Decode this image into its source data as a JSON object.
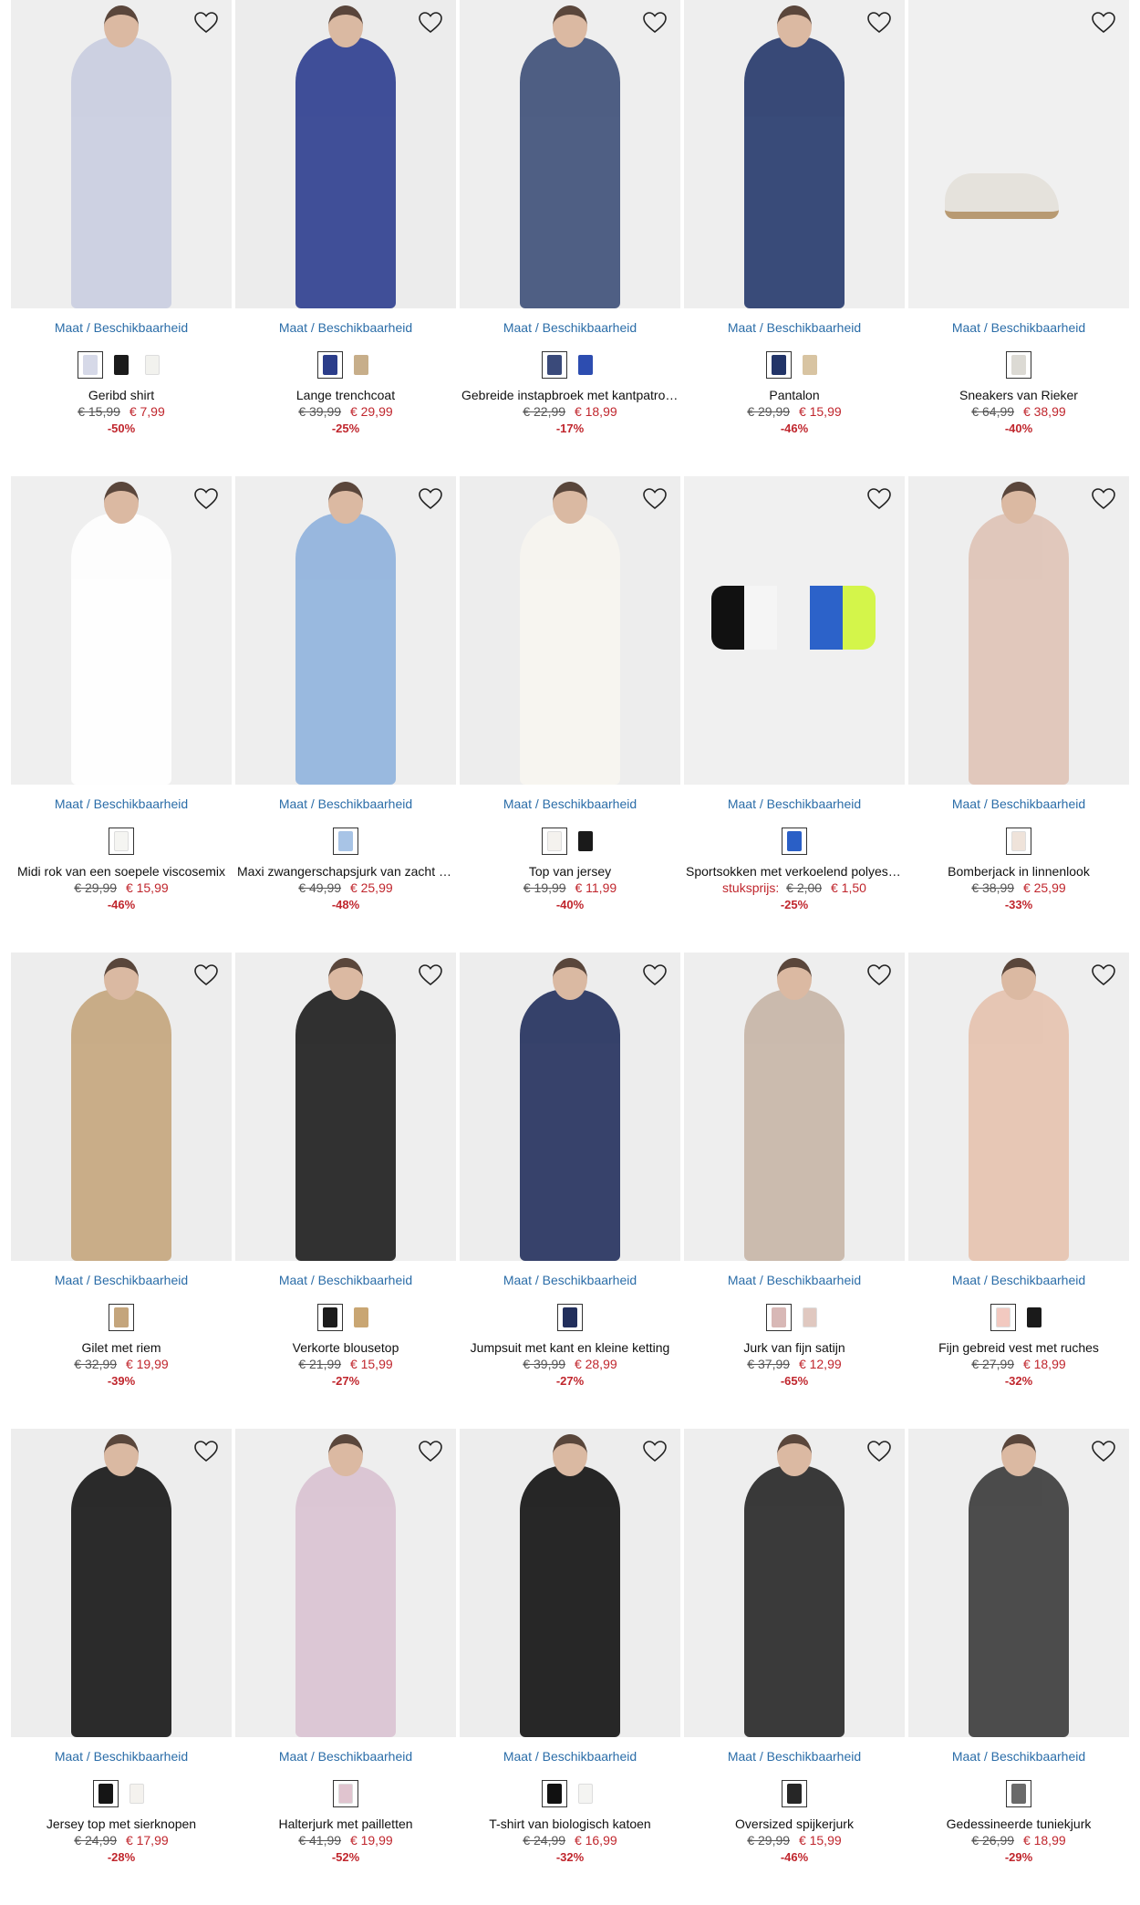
{
  "accent_color": "#2b6da8",
  "sale_color": "#c0262d",
  "size_link_prefix": "Maat",
  "size_link_sep": " / ",
  "size_link_suffix": "Beschikbaarheid",
  "products": [
    {
      "name": "Geribd shirt",
      "old": "€ 15,99",
      "new": "€ 7,99",
      "discount": "-50%",
      "label": "",
      "bg": "#eeeeee",
      "fig": "#c9cde0",
      "swatches": [
        "#d6d9e8",
        "#1b1b1b",
        "#f2f2ee"
      ]
    },
    {
      "name": "Lange trenchcoat",
      "old": "€ 39,99",
      "new": "€ 29,99",
      "discount": "-25%",
      "label": "",
      "bg": "#ececec",
      "fig": "#2d3e8f",
      "swatches": [
        "#2b3d8a",
        "#c7ae8a"
      ]
    },
    {
      "name": "Gebreide instapbroek met kantpatroon",
      "old": "€ 22,99",
      "new": "€ 18,99",
      "discount": "-17%",
      "label": "",
      "bg": "#eeeeee",
      "fig": "#3d4f78",
      "swatches": [
        "#3a4a7a",
        "#2d4db0"
      ]
    },
    {
      "name": "Pantalon",
      "old": "€ 29,99",
      "new": "€ 15,99",
      "discount": "-46%",
      "label": "",
      "bg": "#eeeeee",
      "fig": "#25386b",
      "swatches": [
        "#223468",
        "#d8c4a2"
      ]
    },
    {
      "name": "Sneakers van Rieker",
      "old": "€ 64,99",
      "new": "€ 38,99",
      "discount": "-40%",
      "label": "",
      "bg": "#f0f0f0",
      "fig": "#e5e2dc",
      "swatches": [
        "#dcdad4"
      ]
    },
    {
      "name": "Midi rok van een soepele viscosemix",
      "old": "€ 29,99",
      "new": "€ 15,99",
      "discount": "-46%",
      "label": "",
      "bg": "#efefef",
      "fig": "#ffffff",
      "swatches": [
        "#f5f5f2"
      ]
    },
    {
      "name": "Maxi zwangerschapsjurk van zacht jersey",
      "old": "€ 49,99",
      "new": "€ 25,99",
      "discount": "-48%",
      "label": "",
      "bg": "#eeeeee",
      "fig": "#8fb2dd",
      "swatches": [
        "#a8c4e6"
      ]
    },
    {
      "name": "Top van jersey",
      "old": "€ 19,99",
      "new": "€ 11,99",
      "discount": "-40%",
      "label": "",
      "bg": "#ededed",
      "fig": "#f7f5f0",
      "swatches": [
        "#f4f2ee",
        "#1a1a1a"
      ]
    },
    {
      "name": "Sportsokken met verkoelend polyester",
      "old": "€ 2,00",
      "new": "€ 1,50",
      "discount": "-25%",
      "label": "stuksprijs:",
      "bg": "#f0f0f0",
      "fig": "#2c62c9",
      "swatches": [
        "#2a5fc6"
      ]
    },
    {
      "name": "Bomberjack in linnenlook",
      "old": "€ 38,99",
      "new": "€ 25,99",
      "discount": "-33%",
      "label": "",
      "bg": "#eeeeee",
      "fig": "#dfc3b6",
      "swatches": [
        "#efe3da"
      ]
    },
    {
      "name": "Gilet met riem",
      "old": "€ 32,99",
      "new": "€ 19,99",
      "discount": "-39%",
      "label": "",
      "bg": "#ededed",
      "fig": "#c4a57c",
      "swatches": [
        "#c4a57c"
      ]
    },
    {
      "name": "Verkorte blousetop",
      "old": "€ 21,99",
      "new": "€ 15,99",
      "discount": "-27%",
      "label": "",
      "bg": "#eeeeee",
      "fig": "#1c1c1c",
      "swatches": [
        "#1c1c1c",
        "#c9a673"
      ]
    },
    {
      "name": "Jumpsuit met kant en kleine ketting",
      "old": "€ 39,99",
      "new": "€ 28,99",
      "discount": "-27%",
      "label": "",
      "bg": "#ededed",
      "fig": "#222f5c",
      "swatches": [
        "#222f5c"
      ]
    },
    {
      "name": "Jurk van fijn satijn",
      "old": "€ 37,99",
      "new": "€ 12,99",
      "discount": "-65%",
      "label": "",
      "bg": "#eeeeee",
      "fig": "#c7b5a6",
      "swatches": [
        "#d8b8b6",
        "#e0c8c0"
      ]
    },
    {
      "name": "Fijn gebreid vest met ruches",
      "old": "€ 27,99",
      "new": "€ 18,99",
      "discount": "-32%",
      "label": "",
      "bg": "#eeeeee",
      "fig": "#e6c2ae",
      "swatches": [
        "#f2c9c0",
        "#1a1a1a"
      ]
    },
    {
      "name": "Jersey top met sierknopen",
      "old": "€ 24,99",
      "new": "€ 17,99",
      "discount": "-28%",
      "label": "",
      "bg": "#ededed",
      "fig": "#151515",
      "swatches": [
        "#151515",
        "#f4f2ee"
      ]
    },
    {
      "name": "Halterjurk met pailletten",
      "old": "€ 41,99",
      "new": "€ 19,99",
      "discount": "-52%",
      "label": "",
      "bg": "#eeeeee",
      "fig": "#d9c2d2",
      "swatches": [
        "#e0c4cf"
      ]
    },
    {
      "name": "T-shirt van biologisch katoen",
      "old": "€ 24,99",
      "new": "€ 16,99",
      "discount": "-32%",
      "label": "",
      "bg": "#ededed",
      "fig": "#111111",
      "swatches": [
        "#111111",
        "#f4f4f2"
      ]
    },
    {
      "name": "Oversized spijkerjurk",
      "old": "€ 29,99",
      "new": "€ 15,99",
      "discount": "-46%",
      "label": "",
      "bg": "#eeeeee",
      "fig": "#262626",
      "swatches": [
        "#262626"
      ]
    },
    {
      "name": "Gedessineerde tuniekjurk",
      "old": "€ 26,99",
      "new": "€ 18,99",
      "discount": "-29%",
      "label": "",
      "bg": "#eeeeee",
      "fig": "#3a3a3a",
      "swatches": [
        "#6a6a6a"
      ]
    }
  ]
}
